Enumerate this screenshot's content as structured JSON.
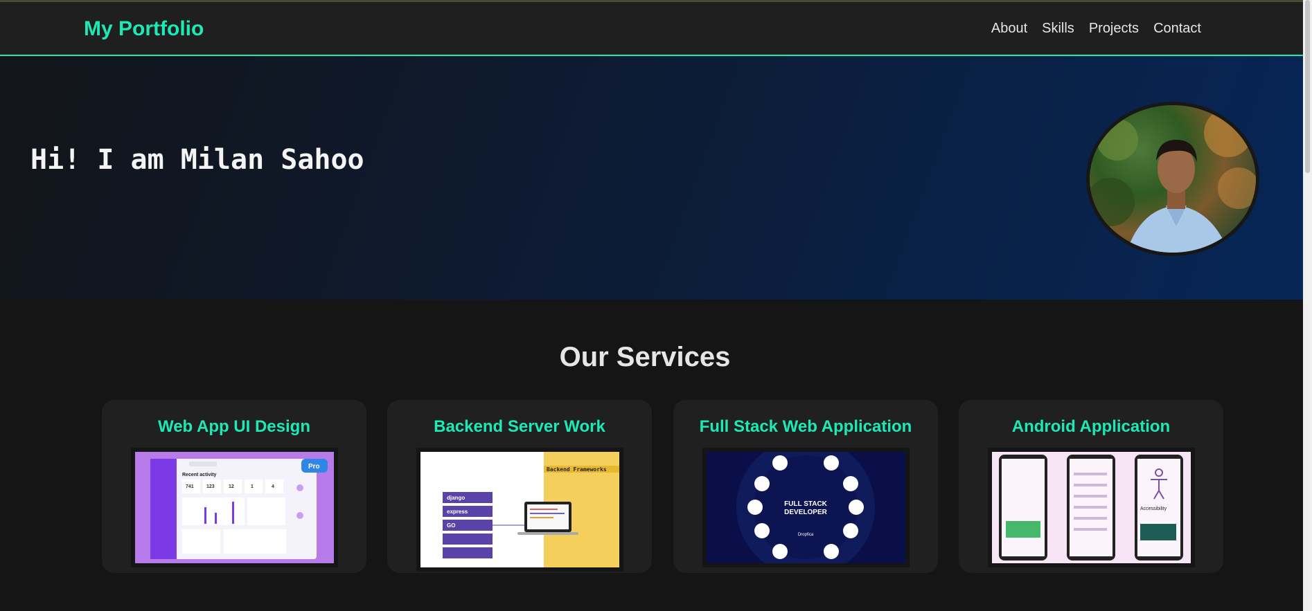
{
  "navbar": {
    "brand": "My Portfolio",
    "links": [
      "About",
      "Skills",
      "Projects",
      "Contact"
    ]
  },
  "hero": {
    "greeting": "Hi! I am Milan Sahoo"
  },
  "services": {
    "title": "Our Services",
    "cards": [
      {
        "title": "Web App UI Design",
        "image": {
          "badge": "Pro",
          "heading": "Recent activity",
          "stats": [
            "741",
            "123",
            "12",
            "1",
            "4"
          ]
        }
      },
      {
        "title": "Backend Server Work",
        "image": {
          "banner": "Backend Frameworks",
          "stack": [
            "django",
            "express",
            "GO",
            "",
            ""
          ]
        }
      },
      {
        "title": "Full Stack Web Application",
        "image": {
          "line1": "FULL STACK",
          "line2": "DEVELOPER",
          "brand": "Dropfica"
        }
      },
      {
        "title": "Android Application",
        "image": {
          "heading": "Accessibility"
        }
      }
    ]
  },
  "colors": {
    "accent": "#1de9b6",
    "background": "#151515",
    "card": "#202020"
  }
}
